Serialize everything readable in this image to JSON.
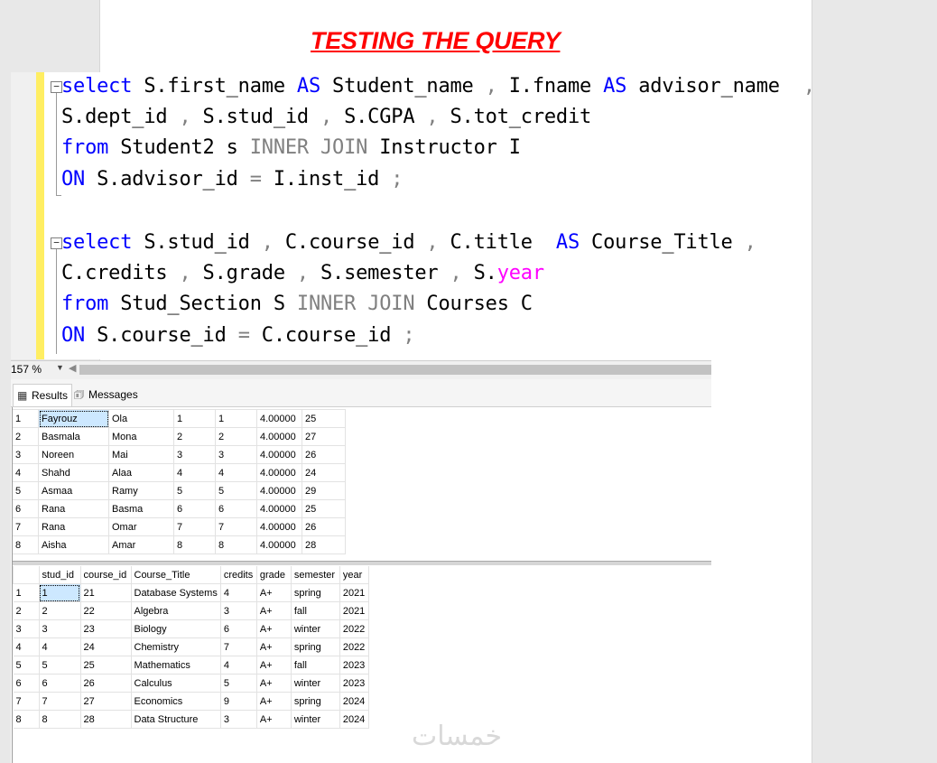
{
  "document": {
    "heading": "TESTING THE QUERY"
  },
  "editor": {
    "zoom": "157 %",
    "query1": {
      "line1": {
        "select": "select",
        "a": " S.first_name ",
        "as1": "AS",
        "b": " Student_name ",
        "c1": ",",
        "b2": " I.fname ",
        "as2": "AS",
        "b3": " advisor_name  ",
        "c2": ","
      },
      "line2": {
        "a": "S.dept_id ",
        "c1": ",",
        "b": " S.stud_id ",
        "c2": ",",
        "c": " S.CGPA ",
        "c3": ",",
        "d": " S.tot_credit"
      },
      "line3": {
        "from": "from",
        "a": " Student2 s ",
        "join": "INNER JOIN",
        "b": " Instructor I"
      },
      "line4": {
        "on": "ON",
        "a": " S.advisor_id ",
        "eq": "=",
        "b": " I.inst_id ",
        "semi": ";"
      }
    },
    "query2": {
      "line1": {
        "select": "select",
        "a": " S.stud_id ",
        "c1": ",",
        "b": " C.course_id ",
        "c2": ",",
        "c": " C.title  ",
        "as1": "AS",
        "d": " Course_Title ",
        "c3": ","
      },
      "line2": {
        "a": "C.credits ",
        "c1": ",",
        "b": " S.grade ",
        "c2": ",",
        "c": " S.semester ",
        "c3": ",",
        "d": " S.",
        "year": "year"
      },
      "line3": {
        "from": "from",
        "a": " Stud_Section S ",
        "join": "INNER JOIN",
        "b": " Courses C"
      },
      "line4": {
        "on": "ON",
        "a": " S.course_id ",
        "eq": "=",
        "b": " C.course_id ",
        "semi": ";"
      }
    }
  },
  "tabs": {
    "results": "Results",
    "messages": "Messages",
    "results_icon": "grid-icon",
    "messages_icon": "messages-icon"
  },
  "grid1": {
    "rows": [
      [
        "1",
        "Fayrouz",
        "Ola",
        "1",
        "1",
        "4.00000",
        "25"
      ],
      [
        "2",
        "Basmala",
        "Mona",
        "2",
        "2",
        "4.00000",
        "27"
      ],
      [
        "3",
        "Noreen",
        "Mai",
        "3",
        "3",
        "4.00000",
        "26"
      ],
      [
        "4",
        "Shahd",
        "Alaa",
        "4",
        "4",
        "4.00000",
        "24"
      ],
      [
        "5",
        "Asmaa",
        "Ramy",
        "5",
        "5",
        "4.00000",
        "29"
      ],
      [
        "6",
        "Rana",
        "Basma",
        "6",
        "6",
        "4.00000",
        "25"
      ],
      [
        "7",
        "Rana",
        "Omar",
        "7",
        "7",
        "4.00000",
        "26"
      ],
      [
        "8",
        "Aisha",
        "Amar",
        "8",
        "8",
        "4.00000",
        "28"
      ]
    ]
  },
  "grid2": {
    "headers": [
      "stud_id",
      "course_id",
      "Course_Title",
      "credits",
      "grade",
      "semester",
      "year"
    ],
    "rows": [
      [
        "1",
        "1",
        "21",
        "Database Systems",
        "4",
        "A+",
        "spring",
        "2021"
      ],
      [
        "2",
        "2",
        "22",
        "Algebra",
        "3",
        "A+",
        "fall",
        "2021"
      ],
      [
        "3",
        "3",
        "23",
        "Biology",
        "6",
        "A+",
        "winter",
        "2022"
      ],
      [
        "4",
        "4",
        "24",
        "Chemistry",
        "7",
        "A+",
        "spring",
        "2022"
      ],
      [
        "5",
        "5",
        "25",
        "Mathematics",
        "4",
        "A+",
        "fall",
        "2023"
      ],
      [
        "6",
        "6",
        "26",
        "Calculus",
        "5",
        "A+",
        "winter",
        "2023"
      ],
      [
        "7",
        "7",
        "27",
        "Economics",
        "9",
        "A+",
        "spring",
        "2024"
      ],
      [
        "8",
        "8",
        "28",
        "Data Structure",
        "3",
        "A+",
        "winter",
        "2024"
      ]
    ]
  },
  "watermark": "خمسات"
}
